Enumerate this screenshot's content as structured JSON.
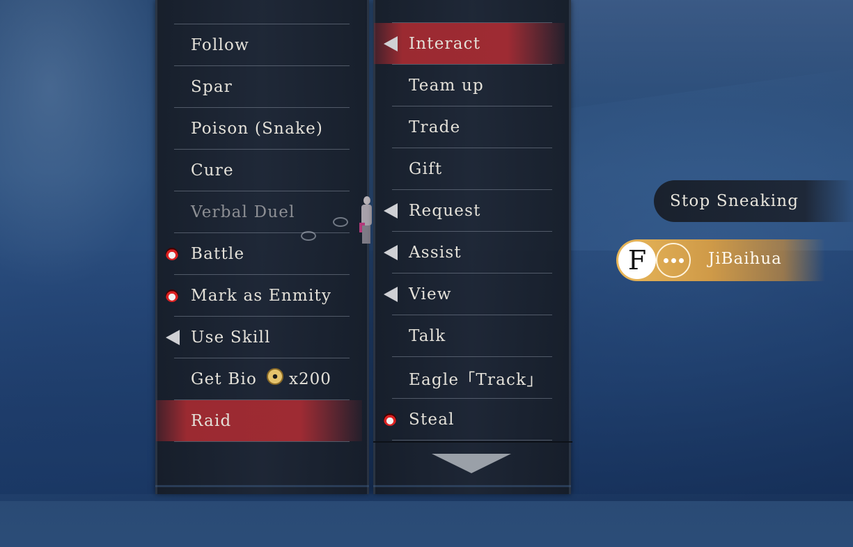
{
  "left_menu": {
    "items": [
      {
        "label": "Follow",
        "state": "normal",
        "icon": null
      },
      {
        "label": "Spar",
        "state": "normal",
        "icon": null
      },
      {
        "label": "Poison (Snake)",
        "state": "normal",
        "icon": null
      },
      {
        "label": "Cure",
        "state": "normal",
        "icon": null
      },
      {
        "label": "Verbal Duel",
        "state": "disabled",
        "icon": null
      },
      {
        "label": "Battle",
        "state": "normal",
        "icon": "demon-mask-icon"
      },
      {
        "label": "Mark as Enmity",
        "state": "normal",
        "icon": "demon-mask-icon"
      },
      {
        "label": "Use Skill",
        "state": "normal",
        "icon": "submenu-arrow-icon"
      },
      {
        "label": "Get Bio",
        "state": "normal",
        "icon": null,
        "cost_icon": "coin-icon",
        "cost": "x200"
      },
      {
        "label": "Raid",
        "state": "selected",
        "icon": null
      }
    ]
  },
  "right_menu": {
    "items": [
      {
        "label": "Interact",
        "state": "selected",
        "icon": "submenu-arrow-icon"
      },
      {
        "label": "Team up",
        "state": "normal",
        "icon": null
      },
      {
        "label": "Trade",
        "state": "normal",
        "icon": null
      },
      {
        "label": "Gift",
        "state": "normal",
        "icon": null
      },
      {
        "label": "Request",
        "state": "normal",
        "icon": "submenu-arrow-icon"
      },
      {
        "label": "Assist",
        "state": "normal",
        "icon": "submenu-arrow-icon"
      },
      {
        "label": "View",
        "state": "normal",
        "icon": "submenu-arrow-icon"
      },
      {
        "label": "Talk",
        "state": "normal",
        "icon": null
      },
      {
        "label": "Eagle「Track」",
        "state": "normal",
        "icon": null
      },
      {
        "label": "Steal",
        "state": "normal",
        "icon": "demon-mask-icon"
      }
    ],
    "scroll_icon": "chevron-down-icon"
  },
  "hud": {
    "stop_sneaking_label": "Stop Sneaking",
    "interact_key": "F",
    "npc_name": "JiBaihua"
  },
  "colors": {
    "selected_red": "#9e2b33",
    "panel_bg": "#1e2532",
    "text": "#e4e1d9",
    "disabled_text": "#8d8f94",
    "prompt_gold": "#e8b75a"
  }
}
